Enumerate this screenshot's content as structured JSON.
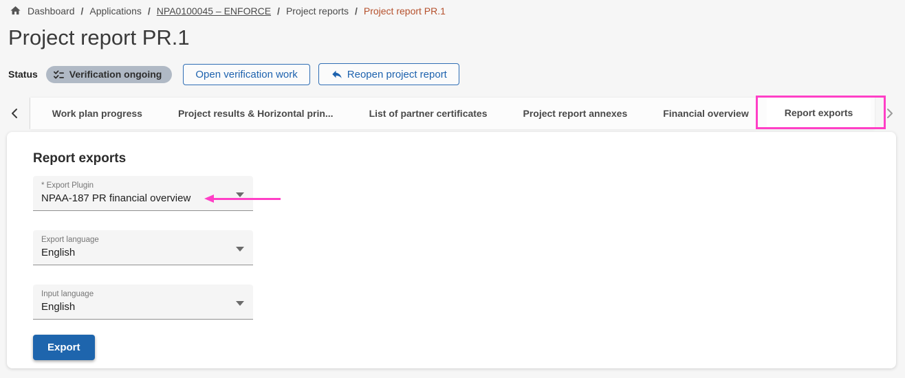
{
  "breadcrumb": {
    "separator": "/",
    "items": [
      {
        "label": "Dashboard"
      },
      {
        "label": "Applications"
      },
      {
        "label": "NPA0100045 – ENFORCE",
        "underlined": true
      },
      {
        "label": "Project reports"
      },
      {
        "label": "Project report PR.1",
        "current": true
      }
    ]
  },
  "header": {
    "title": "Project report PR.1",
    "status_label": "Status",
    "status_value": "Verification ongoing",
    "actions": [
      {
        "label": "Open verification work"
      },
      {
        "label": "Reopen project report"
      }
    ]
  },
  "tabs": {
    "active": "Report exports",
    "items": [
      {
        "label": "Work plan progress"
      },
      {
        "label": "Project results & Horizontal prin..."
      },
      {
        "label": "List of partner certificates"
      },
      {
        "label": "Project report annexes"
      },
      {
        "label": "Financial overview"
      },
      {
        "label": "Report exports"
      }
    ]
  },
  "panel": {
    "heading": "Report exports",
    "fields": [
      {
        "label": "* Export Plugin",
        "value": "NPAA-187 PR financial overview",
        "required": true
      },
      {
        "label": "Export language",
        "value": "English"
      },
      {
        "label": "Input language",
        "value": "English"
      }
    ],
    "export_label": "Export"
  },
  "icons": {
    "breadcrumb": "home-icon",
    "status": "checklist-icon",
    "reopen": "undo-icon",
    "tabs_left": "chevron-left-icon",
    "tabs_right": "chevron-right-icon",
    "dropdown": "caret-down-icon"
  },
  "colors": {
    "accent_blue": "#1d62ae",
    "active_tab_underline": "#1a5dab",
    "status_badge_bg": "#b0b9c5",
    "breadcrumb_current": "#b5502c",
    "annotation_pink": "#ff3fc6",
    "export_button_bg": "#1e65ad",
    "page_bg": "#f6f6f6",
    "panel_bg": "#ffffff"
  }
}
